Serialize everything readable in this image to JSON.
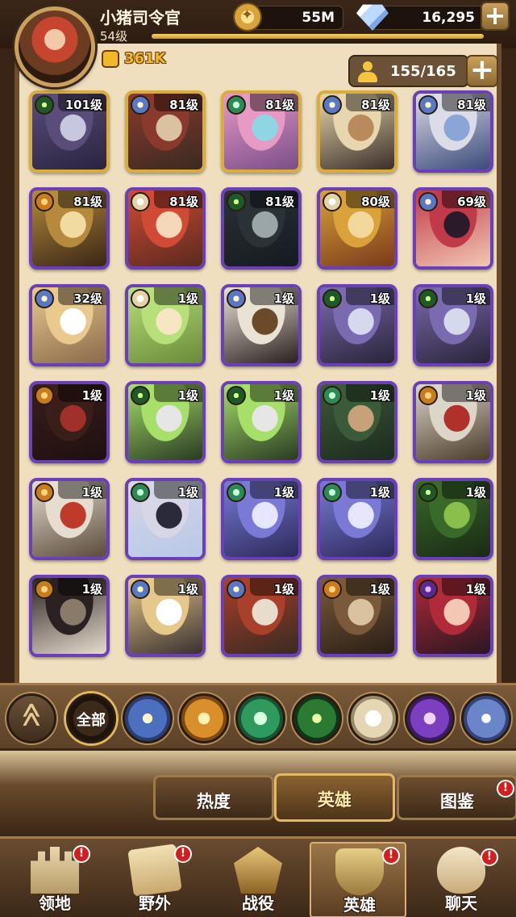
{
  "player": {
    "name": "小猪司令官",
    "level": "54级",
    "power": "361K",
    "xp_progress": 1.0
  },
  "resources": {
    "gold": "55M",
    "gems": "16,295",
    "hero_capacity": "155/165"
  },
  "heroes": [
    {
      "level": "101级",
      "faction": "graveborn",
      "frame": "gold",
      "colors": [
        "#5a4d7a",
        "#c7c8e0",
        "#2a2440"
      ]
    },
    {
      "level": "81级",
      "faction": "lightbearer",
      "frame": "gold",
      "colors": [
        "#8a3a2c",
        "#d8c2a0",
        "#3a2a22"
      ]
    },
    {
      "level": "81级",
      "faction": "wilder",
      "frame": "gold",
      "colors": [
        "#e79ac4",
        "#8fd6e5",
        "#7a4d8a"
      ]
    },
    {
      "level": "81级",
      "faction": "lightbearer",
      "frame": "gold",
      "colors": [
        "#e8d7ae",
        "#b98b5a",
        "#3b2e2a"
      ]
    },
    {
      "level": "81级",
      "faction": "lightbearer",
      "frame": "purple",
      "colors": [
        "#dcdce8",
        "#8ba6d6",
        "#3b4a7a"
      ]
    },
    {
      "level": "81级",
      "faction": "mauler",
      "frame": "purple",
      "colors": [
        "#b58a3c",
        "#f2dba1",
        "#3a2616"
      ]
    },
    {
      "level": "81级",
      "faction": "celestial",
      "frame": "purple",
      "colors": [
        "#d04a36",
        "#f6d8b8",
        "#5a2a1e"
      ]
    },
    {
      "level": "81级",
      "faction": "graveborn",
      "frame": "purple",
      "colors": [
        "#2a3238",
        "#9aa6a8",
        "#151a1e"
      ]
    },
    {
      "level": "80级",
      "faction": "celestial",
      "frame": "purple",
      "colors": [
        "#d9a23b",
        "#f3d89c",
        "#7a3a1a"
      ]
    },
    {
      "level": "69级",
      "faction": "lightbearer",
      "frame": "purple",
      "colors": [
        "#c03a4a",
        "#2a1a2a",
        "#f1c7b2"
      ]
    },
    {
      "level": "32级",
      "faction": "lightbearer",
      "frame": "purple",
      "colors": [
        "#e9c98e",
        "#ffffff",
        "#8a6a4a"
      ]
    },
    {
      "level": "1级",
      "faction": "celestial",
      "frame": "purple",
      "colors": [
        "#b7e07a",
        "#f6e6c2",
        "#6a8a3a"
      ]
    },
    {
      "level": "1级",
      "faction": "lightbearer",
      "frame": "purple",
      "colors": [
        "#e9e3d6",
        "#6a4a2a",
        "#2a2020"
      ]
    },
    {
      "level": "1级",
      "faction": "graveborn",
      "frame": "purple",
      "colors": [
        "#7a6ab0",
        "#d6d8ec",
        "#2a2438"
      ]
    },
    {
      "level": "1级",
      "faction": "graveborn",
      "frame": "purple",
      "colors": [
        "#7a6ab0",
        "#d6d8ec",
        "#2a2438"
      ]
    },
    {
      "level": "1级",
      "faction": "mauler",
      "frame": "purple",
      "colors": [
        "#3a1e1a",
        "#a2302a",
        "#1e1010"
      ]
    },
    {
      "level": "1级",
      "faction": "graveborn",
      "frame": "purple",
      "colors": [
        "#a6e06a",
        "#e6e6e6",
        "#2a3a22"
      ]
    },
    {
      "level": "1级",
      "faction": "graveborn",
      "frame": "purple",
      "colors": [
        "#a6e06a",
        "#e6e6e6",
        "#2a3a22"
      ]
    },
    {
      "level": "1级",
      "faction": "wilder",
      "frame": "purple",
      "colors": [
        "#3a5a3a",
        "#c6a27a",
        "#1e2a1e"
      ]
    },
    {
      "level": "1级",
      "faction": "mauler",
      "frame": "purple",
      "colors": [
        "#dcd6c8",
        "#b0302a",
        "#4a3a2a"
      ]
    },
    {
      "level": "1级",
      "faction": "mauler",
      "frame": "purple",
      "colors": [
        "#e6ddd0",
        "#c03a2a",
        "#5a4a3a"
      ]
    },
    {
      "level": "1级",
      "faction": "wilder",
      "frame": "purple",
      "colors": [
        "#d6d6e6",
        "#2a2a3a",
        "#b8c8e8"
      ]
    },
    {
      "level": "1级",
      "faction": "wilder",
      "frame": "purple",
      "colors": [
        "#7a7ad6",
        "#e6e6ff",
        "#2a2a5a"
      ]
    },
    {
      "level": "1级",
      "faction": "wilder",
      "frame": "purple",
      "colors": [
        "#7a7ad6",
        "#e6e6ff",
        "#2a2a5a"
      ]
    },
    {
      "level": "1级",
      "faction": "graveborn",
      "frame": "purple",
      "colors": [
        "#3a6a2a",
        "#8abf4a",
        "#1a2a14"
      ]
    },
    {
      "level": "1级",
      "faction": "mauler",
      "frame": "purple",
      "colors": [
        "#2a2222",
        "#8a7a6a",
        "#e6dccc"
      ]
    },
    {
      "level": "1级",
      "faction": "lightbearer",
      "frame": "purple",
      "colors": [
        "#e6c88a",
        "#ffffff",
        "#3a3030"
      ]
    },
    {
      "level": "1级",
      "faction": "lightbearer",
      "frame": "purple",
      "colors": [
        "#a8402a",
        "#e8dccc",
        "#3a2a22"
      ]
    },
    {
      "level": "1级",
      "faction": "mauler",
      "frame": "purple",
      "colors": [
        "#7a5a3a",
        "#d8c2a0",
        "#2a1e16"
      ]
    },
    {
      "level": "1级",
      "faction": "hypogean",
      "frame": "purple",
      "colors": [
        "#b02a3a",
        "#f2c8b4",
        "#2a1620"
      ]
    }
  ],
  "filters": {
    "sort": "≪",
    "all": "全部",
    "factions": [
      "lightbearer",
      "mauler",
      "wilder",
      "graveborn",
      "celestial",
      "hypogean",
      "dimensional"
    ]
  },
  "subtabs": [
    "热度",
    "英雄",
    "图鉴"
  ],
  "nav": [
    {
      "label": "领地",
      "icon": "castle-icon",
      "alert": "!"
    },
    {
      "label": "野外",
      "icon": "scroll-map-icon",
      "alert": "!"
    },
    {
      "label": "战役",
      "icon": "campaign-crest-icon",
      "alert": ""
    },
    {
      "label": "英雄",
      "icon": "hero-helmet-icon",
      "alert": "!"
    },
    {
      "label": "聊天",
      "icon": "chat-bubble-icon",
      "alert": "!"
    }
  ]
}
